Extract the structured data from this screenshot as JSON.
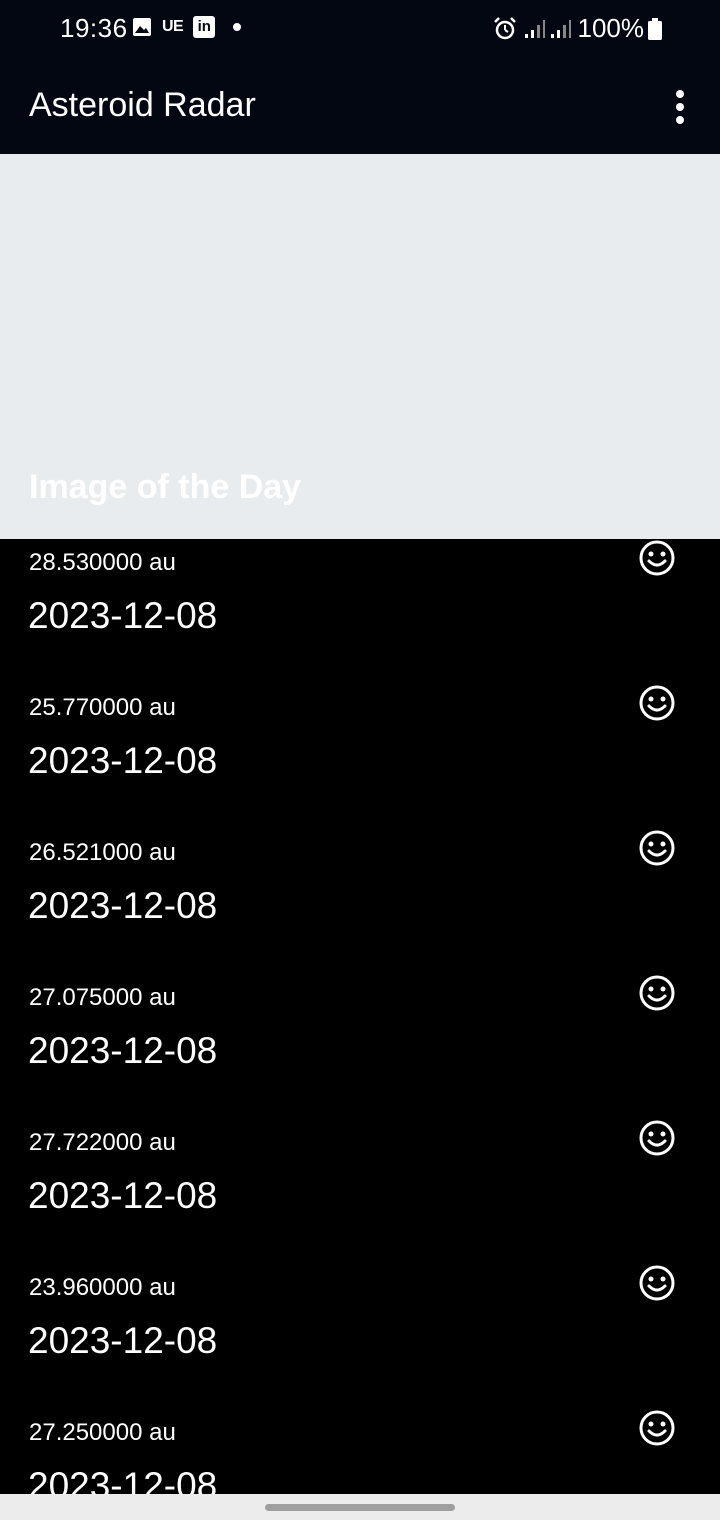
{
  "status_bar": {
    "time": "19:36",
    "carrier_badge": "UE",
    "linkedin_badge": "in",
    "battery": "100%"
  },
  "app_bar": {
    "title": "Asteroid Radar"
  },
  "image_of_day": {
    "title": "Image of the Day"
  },
  "asteroids": [
    {
      "distance": "28.530000 au",
      "date": "2023-12-08",
      "status_icon": "smiley-icon"
    },
    {
      "distance": "25.770000 au",
      "date": "2023-12-08",
      "status_icon": "smiley-icon"
    },
    {
      "distance": "26.521000 au",
      "date": "2023-12-08",
      "status_icon": "smiley-icon"
    },
    {
      "distance": "27.075000 au",
      "date": "2023-12-08",
      "status_icon": "smiley-icon"
    },
    {
      "distance": "27.722000 au",
      "date": "2023-12-08",
      "status_icon": "smiley-icon"
    },
    {
      "distance": "23.960000 au",
      "date": "2023-12-08",
      "status_icon": "smiley-icon"
    },
    {
      "distance": "27.250000 au",
      "date": "2023-12-08",
      "status_icon": "smiley-icon"
    }
  ],
  "colors": {
    "app_bar": "#030712",
    "image_placeholder": "#e9ecee",
    "list_background": "#000000",
    "text": "#ffffff"
  }
}
